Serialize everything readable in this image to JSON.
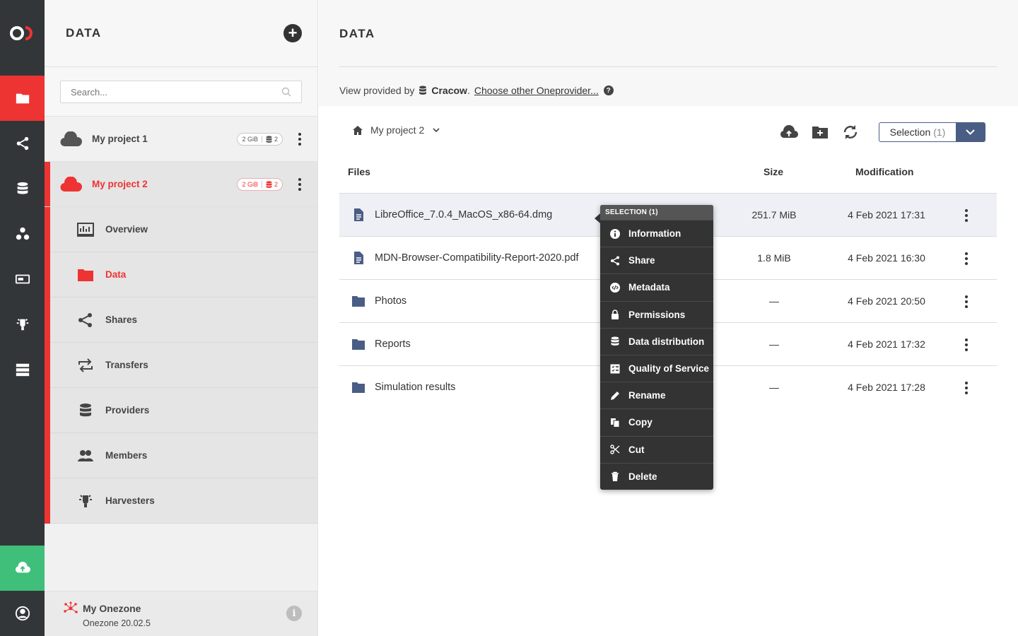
{
  "colors": {
    "accent": "#ee3333",
    "rail_bg": "#333638",
    "upload_green": "#3fbf7a",
    "selection_blue": "#4a5d85"
  },
  "rail": {
    "logo_text": "OD",
    "items": [
      {
        "icon": "folder-icon",
        "active": true
      },
      {
        "icon": "share-icon"
      },
      {
        "icon": "database-icon"
      },
      {
        "icon": "groups-icon"
      },
      {
        "icon": "tokens-icon"
      },
      {
        "icon": "harvester-icon"
      },
      {
        "icon": "clusters-icon"
      },
      {
        "icon": "upload-icon"
      },
      {
        "icon": "user-icon"
      }
    ]
  },
  "sidebar": {
    "title": "DATA",
    "search_placeholder": "Search...",
    "spaces": [
      {
        "name": "My project 1",
        "size": "2 GiB",
        "providers": "2",
        "active": false
      },
      {
        "name": "My project 2",
        "size": "2 GiB",
        "providers": "2",
        "active": true
      }
    ],
    "submenu": [
      {
        "label": "Overview",
        "icon": "overview-icon"
      },
      {
        "label": "Data",
        "icon": "folder-icon",
        "active": true
      },
      {
        "label": "Shares",
        "icon": "share-icon"
      },
      {
        "label": "Transfers",
        "icon": "transfers-icon"
      },
      {
        "label": "Providers",
        "icon": "database-icon"
      },
      {
        "label": "Members",
        "icon": "members-icon"
      },
      {
        "label": "Harvesters",
        "icon": "harvester-icon"
      }
    ],
    "footer": {
      "zone_name": "My Onezone",
      "zone_version": "Onezone 20.02.5"
    }
  },
  "main": {
    "title": "DATA",
    "provider": {
      "prefix": "View provided by",
      "name": "Cracow",
      "period": ".",
      "choose_link": "Choose other Oneprovider...",
      "help": "?"
    },
    "breadcrumb": {
      "current": "My project 2"
    },
    "selection_button": {
      "label": "Selection",
      "count": "(1)"
    },
    "columns": {
      "files": "Files",
      "size": "Size",
      "modification": "Modification"
    },
    "files": [
      {
        "name": "LibreOffice_7.0.4_MacOS_x86-64.dmg",
        "type": "file",
        "size": "251.7 MiB",
        "modified": "4 Feb 2021 17:31",
        "selected": true
      },
      {
        "name": "MDN-Browser-Compatibility-Report-2020.pdf",
        "type": "file",
        "size": "1.8 MiB",
        "modified": "4 Feb 2021 16:30"
      },
      {
        "name": "Photos",
        "type": "dir",
        "size": "—",
        "modified": "4 Feb 2021 20:50"
      },
      {
        "name": "Reports",
        "type": "dir",
        "size": "—",
        "modified": "4 Feb 2021 17:32"
      },
      {
        "name": "Simulation results",
        "type": "dir",
        "size": "—",
        "modified": "4 Feb 2021 17:28"
      }
    ]
  },
  "context_menu": {
    "header": "SELECTION (1)",
    "items": [
      {
        "label": "Information",
        "icon": "info-icon"
      },
      {
        "label": "Share",
        "icon": "share-icon"
      },
      {
        "label": "Metadata",
        "icon": "metadata-icon"
      },
      {
        "label": "Permissions",
        "icon": "lock-icon"
      },
      {
        "label": "Data distribution",
        "icon": "database-icon"
      },
      {
        "label": "Quality of Service",
        "icon": "qos-icon"
      },
      {
        "label": "Rename",
        "icon": "pencil-icon"
      },
      {
        "label": "Copy",
        "icon": "copy-icon"
      },
      {
        "label": "Cut",
        "icon": "scissors-icon"
      },
      {
        "label": "Delete",
        "icon": "trash-icon"
      }
    ]
  }
}
